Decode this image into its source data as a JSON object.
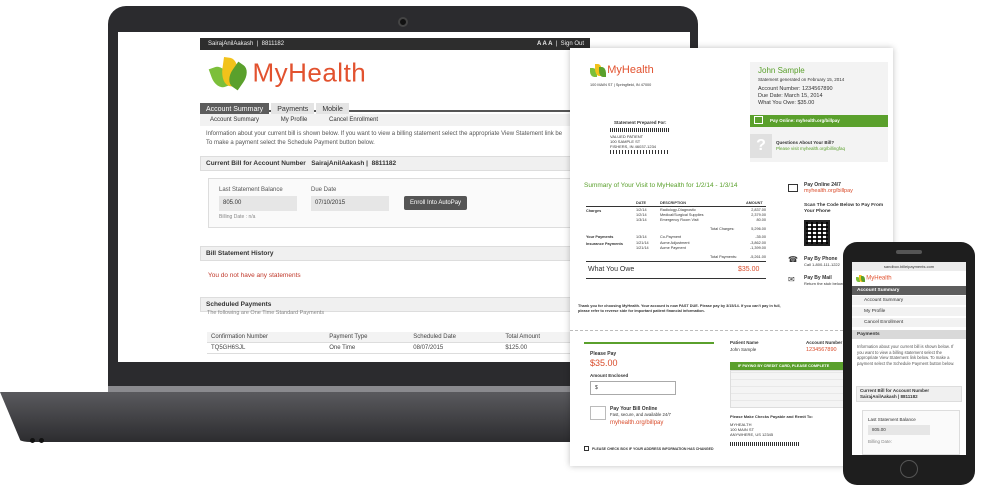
{
  "laptop": {
    "topbar": {
      "user": "SairajAnilAakash",
      "account": "8811182",
      "font_sizes": "A A A",
      "sign_out": "Sign Out"
    },
    "logo": {
      "text": "MyHealth"
    },
    "tabs": [
      {
        "label": "Account Summary"
      },
      {
        "label": "Payments"
      },
      {
        "label": "Mobile"
      }
    ],
    "subtabs": [
      {
        "label": "Account Summary"
      },
      {
        "label": "My Profile"
      },
      {
        "label": "Cancel Enrollment"
      }
    ],
    "info_line1": "Information about your current bill is shown below. If you want to view a billing statement select the appropriate View Statement link be",
    "info_line2": "To make a payment select the Schedule Payment button below.",
    "current_bill": {
      "heading_label": "Current Bill for Account Number",
      "heading_name": "SairajAnilAakash",
      "heading_account": "8811182",
      "last_balance_label": "Last Statement Balance",
      "last_balance_value": "805.00",
      "due_date_label": "Due Date",
      "due_date_value": "07/10/2015",
      "autopay_button": "Enroll Into AutoPay",
      "billing_date": "Billing Date : n/a"
    },
    "history": {
      "heading": "Bill Statement History",
      "empty": "You do not have any statements"
    },
    "scheduled": {
      "heading": "Scheduled Payments",
      "sub": "The following are One Time Standard Payments",
      "columns": [
        "Confirmation Number",
        "Payment Type",
        "Scheduled Date",
        "Total Amount"
      ],
      "rows": [
        [
          "TQ5GH6SJL",
          "One Time",
          "08/07/2015",
          "$125.00"
        ]
      ]
    }
  },
  "statement": {
    "logo_text": "MyHealth",
    "address": "100 MAIN ST | Springfield, IN 47000",
    "patient_name": "John Sample",
    "generated": "Statement generated on February 15, 2014",
    "account_number": "Account Number: 1234567890",
    "due_date": "Due Date: March 15, 2014",
    "what_you_owe_line": "What You Owe: $35.00",
    "pay_online_banner": "Pay Online: myhealth.org/billpay",
    "questions_title": "Questions About Your Bill?",
    "questions_link": "Please visit myhealth.org/billingfaq",
    "prepared_for": "Statement Prepared For:",
    "recipient": [
      "VALUED PATIENT",
      "100 SAMPLE ST",
      "FISHERS, IN 46037-1234"
    ],
    "summary_title": "Summary of Your Visit to MyHealth for 1/2/14 - 1/3/14",
    "table_headers": [
      "DATE",
      "DESCRIPTION",
      "AMOUNT"
    ],
    "charges_label": "Charges",
    "charges": [
      [
        "1/2/14",
        "Radiology-Diagnostic",
        "2,837.00"
      ],
      [
        "1/2/14",
        "Medical/Surgical Supplies",
        "2,379.00"
      ],
      [
        "1/3/14",
        "Emergency Room Visit",
        "80.00"
      ]
    ],
    "total_charges": [
      "Total Charges:",
      "5,296.00"
    ],
    "your_payments_label": "Your Payments",
    "your_payments": [
      "1/3/14",
      "Co-Payment",
      "-35.00"
    ],
    "insurance_label": "Insurance Payments",
    "insurance": [
      [
        "1/21/14",
        "Acme Adjustment",
        "-3,862.00"
      ],
      [
        "1/21/14",
        "Acme Payment",
        "-1,399.00"
      ]
    ],
    "total_payments": [
      "Total Payments:",
      "-5,261.00"
    ],
    "owe_label": "What You Owe",
    "owe_value": "$35.00",
    "pay_online_title": "Pay Online 24/7",
    "pay_online_url": "myhealth.org/billpay",
    "scan_text": "Scan The Code Below to Pay From Your Phone",
    "pay_phone_title": "Pay By Phone",
    "pay_phone_num": "Call 1-800-111-1222",
    "pay_mail_title": "Pay By Mail",
    "pay_mail_text": "Return the stub below with credit card, check",
    "thanks": "Thank you for choosing MyHealth. Your account is now PAST DUE. Please pay by 3/15/14. If you can't pay in full, please refer to reverse side for important patient financial information.",
    "stub_please_pay": "Please Pay",
    "stub_amount": "$35.00",
    "stub_amount_enclosed": "Amount Enclosed",
    "stub_dollar": "$",
    "stub_pay_title": "Pay Your Bill Online",
    "stub_pay_sub": "Fast, secure, and available 24/7",
    "stub_pay_url": "myhealth.org/billpay",
    "stub_patient_name_label": "Patient Name",
    "stub_patient_name": "John Sample",
    "stub_account_label": "Account Number",
    "stub_account": "1234567890",
    "stub_card_banner": "IF PAYING BY CREDIT CARD, PLEASE COMPLETE",
    "stub_checks": "Please Make Checks Payable and Remit To:",
    "stub_remit": [
      "MYHEALTH",
      "100 MAIN ST",
      "ANYWHERE, US 12345"
    ],
    "stub_footer": "PLEASE CHECK BOX IF YOUR ADDRESS INFORMATION HAS CHANGED"
  },
  "phone": {
    "url": "sandbox.billeipayments.com",
    "logo_text": "MyHealth",
    "menu_header": "Account Summary",
    "menu_items": [
      "Account Summary",
      "My Profile",
      "Cancel Enrollment"
    ],
    "payments": "Payments",
    "info": "Information about your current bill is shown below. If you want to view a billing statement select the appropriate View Statement link below. To make a payment select the Schedule Payment button below.",
    "bill_heading": "Current Bill for Account Number",
    "bill_name": "SairajAnilAakash",
    "bill_account": "8811182",
    "last_balance_label": "Last Statement Balance",
    "last_balance_value": "805.00",
    "billing_date": "Billing Date:"
  },
  "colors": {
    "brand_red": "#e2522f",
    "brand_green": "#5aa02c",
    "dark": "#2b2b2e"
  }
}
